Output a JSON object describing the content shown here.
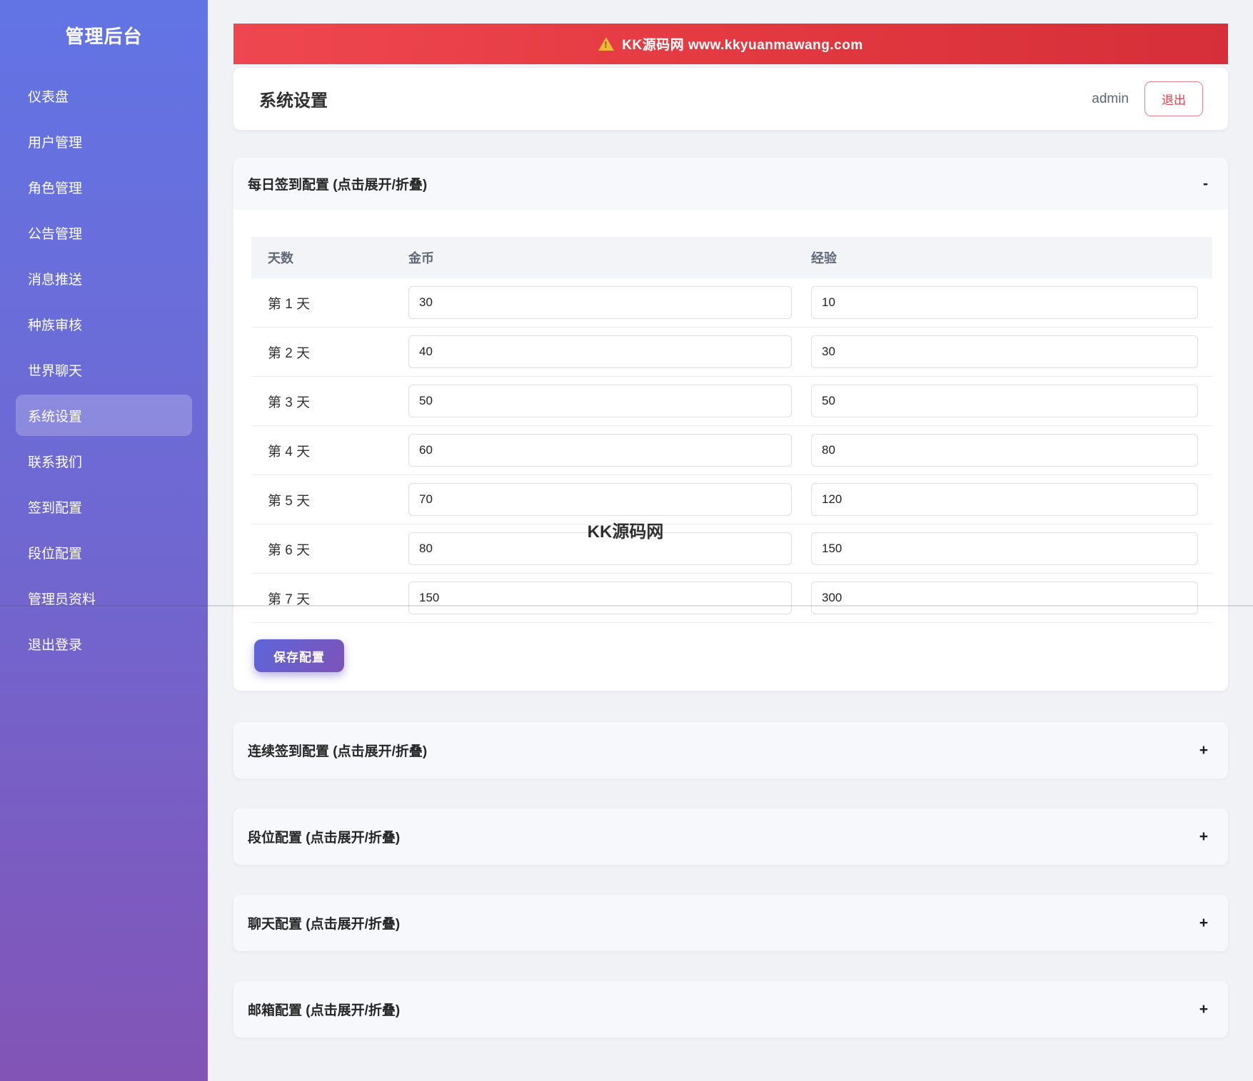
{
  "sidebar": {
    "title": "管理后台",
    "items": [
      {
        "label": "仪表盘",
        "active": false
      },
      {
        "label": "用户管理",
        "active": false
      },
      {
        "label": "角色管理",
        "active": false
      },
      {
        "label": "公告管理",
        "active": false
      },
      {
        "label": "消息推送",
        "active": false
      },
      {
        "label": "种族审核",
        "active": false
      },
      {
        "label": "世界聊天",
        "active": false
      },
      {
        "label": "系统设置",
        "active": true
      },
      {
        "label": "联系我们",
        "active": false
      },
      {
        "label": "签到配置",
        "active": false
      },
      {
        "label": "段位配置",
        "active": false
      },
      {
        "label": "管理员资料",
        "active": false
      },
      {
        "label": "退出登录",
        "active": false
      }
    ]
  },
  "banner": {
    "icon": "warning-icon",
    "text": "KK源码网 www.kkyuanmawang.com"
  },
  "header": {
    "title": "系统设置",
    "username": "admin",
    "logout_label": "退出"
  },
  "sections": {
    "daily": {
      "title": "每日签到配置 (点击展开/折叠)",
      "toggle": "-",
      "table": {
        "headers": [
          "天数",
          "金币",
          "经验"
        ],
        "rows": [
          {
            "day": "第 1 天",
            "gold": "30",
            "exp": "10"
          },
          {
            "day": "第 2 天",
            "gold": "40",
            "exp": "30"
          },
          {
            "day": "第 3 天",
            "gold": "50",
            "exp": "50"
          },
          {
            "day": "第 4 天",
            "gold": "60",
            "exp": "80"
          },
          {
            "day": "第 5 天",
            "gold": "70",
            "exp": "120"
          },
          {
            "day": "第 6 天",
            "gold": "80",
            "exp": "150"
          },
          {
            "day": "第 7 天",
            "gold": "150",
            "exp": "300"
          }
        ]
      },
      "save_label": "保存配置"
    },
    "collapsed": [
      {
        "key": "continuous-signin",
        "title": "连续签到配置 (点击展开/折叠)",
        "toggle": "+"
      },
      {
        "key": "rank",
        "title": "段位配置 (点击展开/折叠)",
        "toggle": "+"
      },
      {
        "key": "chat",
        "title": "聊天配置 (点击展开/折叠)",
        "toggle": "+"
      },
      {
        "key": "mail",
        "title": "邮箱配置 (点击展开/折叠)",
        "toggle": "+"
      }
    ]
  },
  "watermark": "KK源码网",
  "colors": {
    "sidebar_top": "#6274e4",
    "sidebar_bottom": "#8254b6",
    "banner_red": "#e23840",
    "accent_gradient_start": "#5e66da",
    "accent_gradient_end": "#7d53b8",
    "logout_red": "#d9444f",
    "page_background": "#f1f2f6"
  }
}
